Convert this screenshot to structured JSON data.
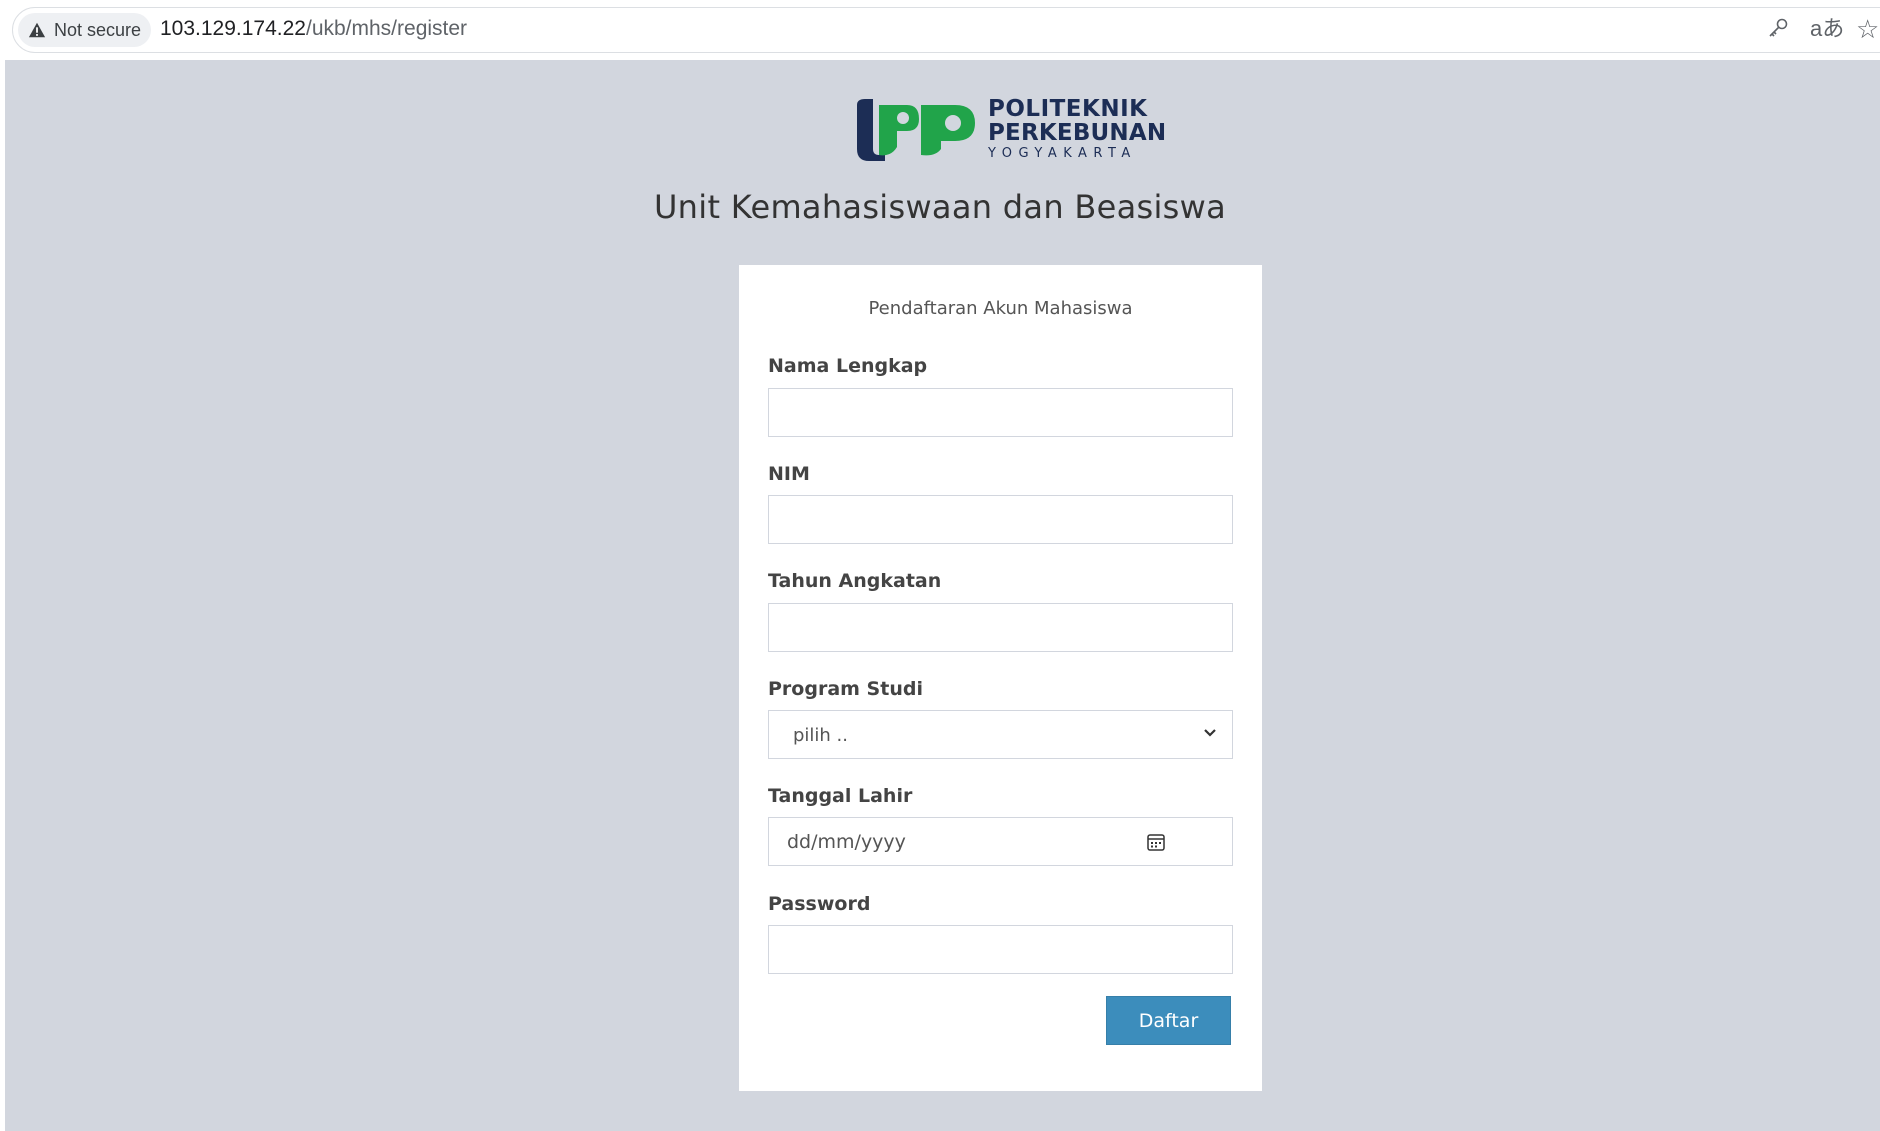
{
  "browser": {
    "security_label": "Not secure",
    "url_host": "103.129.174.22",
    "url_path": "/ukb/mhs/register",
    "icons": [
      "warning-icon",
      "key-icon",
      "translate-icon",
      "bookmark-star-icon"
    ]
  },
  "logo": {
    "line1": "POLITEKNIK",
    "line2": "PERKEBUNAN",
    "line3": "YOGYAKARTA",
    "colors": {
      "navy": "#1c2d55",
      "green": "#21a44a"
    }
  },
  "app_title": "Unit Kemahasiswaan dan Beasiswa",
  "form": {
    "title": "Pendaftaran Akun Mahasiswa",
    "fields": {
      "nama": {
        "label": "Nama Lengkap",
        "value": ""
      },
      "nim": {
        "label": "NIM",
        "value": ""
      },
      "tahun": {
        "label": "Tahun Angkatan",
        "value": ""
      },
      "prodi": {
        "label": "Program Studi",
        "selected": "pilih .."
      },
      "tanggal": {
        "label": "Tanggal Lahir",
        "placeholder": "dd/mm/yyyy"
      },
      "password": {
        "label": "Password",
        "value": ""
      }
    },
    "submit_label": "Daftar",
    "colors": {
      "page_bg": "#d2d6de",
      "button": "#3c8dbc"
    }
  }
}
